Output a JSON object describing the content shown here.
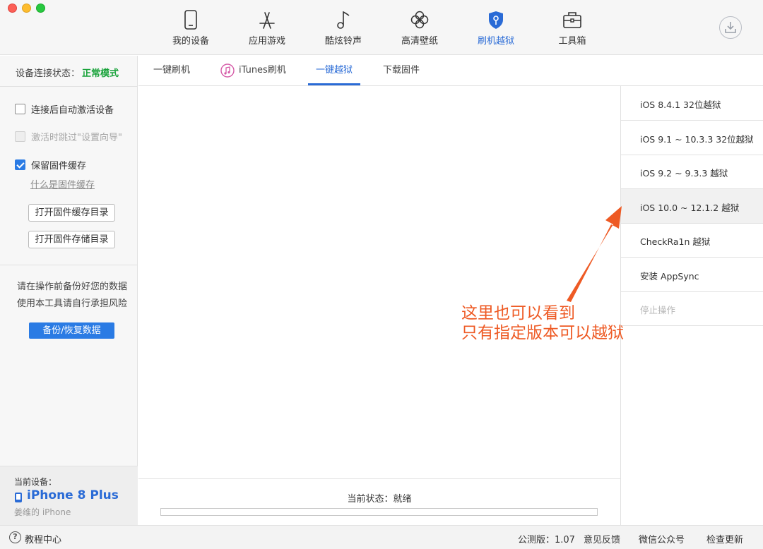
{
  "nav": {
    "items": [
      {
        "label": "我的设备",
        "icon": "phone-icon"
      },
      {
        "label": "应用游戏",
        "icon": "app-store-icon"
      },
      {
        "label": "酷炫铃声",
        "icon": "music-note-icon"
      },
      {
        "label": "高清壁纸",
        "icon": "flower-icon"
      },
      {
        "label": "刷机越狱",
        "icon": "shield-icon",
        "active": true
      },
      {
        "label": "工具箱",
        "icon": "toolbox-icon"
      }
    ],
    "download_icon": "download-icon"
  },
  "sidebar": {
    "status_label": "设备连接状态：",
    "status_value": "正常模式",
    "options": [
      {
        "label": "连接后自动激活设备",
        "checked": false,
        "disabled": false
      },
      {
        "label": "激活时跳过\"设置向导\"",
        "checked": false,
        "disabled": true
      },
      {
        "label": "保留固件缓存",
        "checked": true,
        "disabled": false
      }
    ],
    "link": "什么是固件缓存",
    "buttons": [
      "打开固件缓存目录",
      "打开固件存储目录"
    ],
    "warning_lines": [
      "请在操作前备份好您的数据",
      "使用本工具请自行承担风险"
    ],
    "backup_button": "备份/恢复数据",
    "device_title": "当前设备：",
    "device_name": "iPhone 8 Plus",
    "device_owner": "姜维的 iPhone"
  },
  "tabs": [
    "一键刷机",
    "iTunes刷机",
    "一键越狱",
    "下载固件"
  ],
  "active_tab": "一键越狱",
  "jailbreak_list": [
    "iOS 8.4.1 32位越狱",
    "iOS 9.1 ~ 10.3.3 32位越狱",
    "iOS 9.2 ~ 9.3.3 越狱",
    "iOS 10.0 ~ 12.1.2 越狱",
    "CheckRa1n 越狱",
    "安装 AppSync",
    "停止操作"
  ],
  "status": {
    "text": "当前状态：就绪",
    "progress": 0
  },
  "annotation": {
    "line1": "这里也可以看到",
    "line2": "只有指定版本可以越狱",
    "color": "#ee5a24"
  },
  "footer": {
    "help": "教程中心",
    "version": "公测版：1.07",
    "feedback": "意见反馈",
    "wechat": "微信公众号",
    "update": "检查更新"
  },
  "colors": {
    "accent": "#2a6bd6",
    "status_ok": "#1aa33b"
  }
}
